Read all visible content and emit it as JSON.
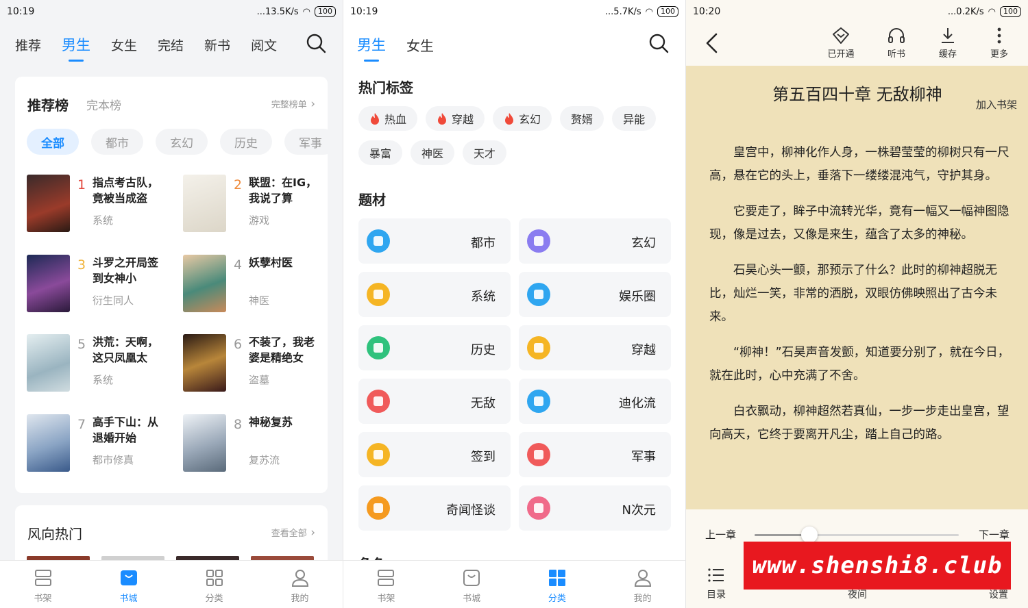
{
  "panel1": {
    "status": {
      "time": "10:19",
      "net": "...13.5K/s",
      "battery": "100"
    },
    "tabs": [
      "推荐",
      "男生",
      "女生",
      "完结",
      "新书",
      "阅文"
    ],
    "active_tab": 1,
    "rank": {
      "title": "推荐榜",
      "sub": "完本榜",
      "more": "完整榜单",
      "chips": [
        "全部",
        "都市",
        "玄幻",
        "历史",
        "军事"
      ],
      "books": [
        {
          "rank": "1",
          "title": "指点考古队，竟被当成盗",
          "tag": "系统"
        },
        {
          "rank": "2",
          "title": "联盟：在IG，我说了算",
          "tag": "游戏"
        },
        {
          "rank": "3",
          "title": "斗罗之开局签到女神小",
          "tag": "衍生同人"
        },
        {
          "rank": "4",
          "title": "妖孽村医",
          "tag": "神医"
        },
        {
          "rank": "5",
          "title": "洪荒：天啊，这只凤凰太",
          "tag": "系统"
        },
        {
          "rank": "6",
          "title": "不装了，我老婆是精绝女",
          "tag": "盗墓"
        },
        {
          "rank": "7",
          "title": "高手下山：从退婚开始",
          "tag": "都市修真"
        },
        {
          "rank": "8",
          "title": "神秘复苏",
          "tag": "复苏流"
        }
      ]
    },
    "trend": {
      "title": "风向热门",
      "more": "查看全部"
    },
    "bottom_nav": [
      "书架",
      "书城",
      "分类",
      "我的"
    ],
    "bottom_active": 1
  },
  "panel2": {
    "status": {
      "time": "10:19",
      "net": "...5.7K/s",
      "battery": "100"
    },
    "tabs": [
      "男生",
      "女生"
    ],
    "hot_tags_title": "热门标签",
    "hot_tags": [
      {
        "label": "热血",
        "hot": true
      },
      {
        "label": "穿越",
        "hot": true
      },
      {
        "label": "玄幻",
        "hot": true
      },
      {
        "label": "赘婿",
        "hot": false
      },
      {
        "label": "异能",
        "hot": false
      },
      {
        "label": "暴富",
        "hot": false
      },
      {
        "label": "神医",
        "hot": false
      },
      {
        "label": "天才",
        "hot": false
      }
    ],
    "genre_title": "题材",
    "genres": [
      {
        "label": "都市",
        "color": "#2fa6f0"
      },
      {
        "label": "玄幻",
        "color": "#8a7cf0"
      },
      {
        "label": "系统",
        "color": "#f5b524"
      },
      {
        "label": "娱乐圈",
        "color": "#2fa6f0"
      },
      {
        "label": "历史",
        "color": "#2fc27d"
      },
      {
        "label": "穿越",
        "color": "#f5b524"
      },
      {
        "label": "无敌",
        "color": "#f05a5a"
      },
      {
        "label": "迪化流",
        "color": "#2fa6f0"
      },
      {
        "label": "签到",
        "color": "#f5b524"
      },
      {
        "label": "军事",
        "color": "#f05a5a"
      },
      {
        "label": "奇闻怪谈",
        "color": "#f59a1f"
      },
      {
        "label": "N次元",
        "color": "#f06a8a"
      }
    ],
    "more_title": "角色",
    "bottom_nav": [
      "书架",
      "书城",
      "分类",
      "我的"
    ],
    "bottom_active": 2
  },
  "panel3": {
    "status": {
      "time": "10:20",
      "net": "...0.2K/s",
      "battery": "100"
    },
    "top_buttons": [
      "已开通",
      "听书",
      "缓存",
      "更多"
    ],
    "chapter_title": "第五百四十章 无敌柳神",
    "add_shelf": "加入书架",
    "paragraphs": [
      "皇宫中，柳神化作人身，一株碧莹莹的柳树只有一尺高，悬在它的头上，垂落下一缕缕混沌气，守护其身。",
      "它要走了，眸子中流转光华，竟有一幅又一幅神图隐现，像是过去，又像是来生，蕴含了太多的神秘。",
      "石昊心头一颤，那预示了什么？此时的柳神超脱无比，灿烂一笑，非常的洒脱，双眼仿佛映照出了古今未来。",
      "“柳神！”石昊声音发颤，知道要分别了，就在今日，就在此时，心中充满了不舍。",
      "白衣飘动，柳神超然若真仙，一步一步走出皇宫，望向高天，它终于要离开凡尘，踏上自己的路。"
    ],
    "prev": "上一章",
    "next": "下一章",
    "progress": 0.27,
    "bottom_buttons": [
      "目录",
      "夜间",
      "设置"
    ],
    "watermark": "www.shenshi8.club"
  }
}
